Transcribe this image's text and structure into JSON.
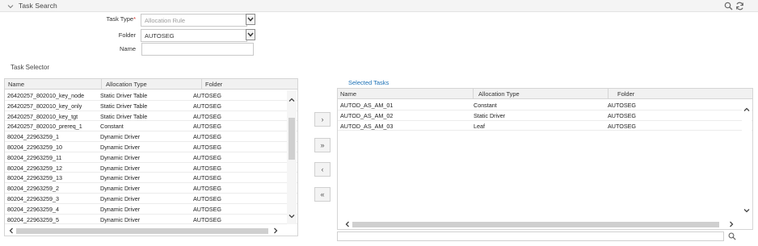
{
  "task_search": {
    "title": "Task Search",
    "task_type_label": "Task Type",
    "required_mark": "*",
    "task_type_placeholder": "Allocation Rule",
    "folder_label": "Folder",
    "folder_value": "AUTOSEG",
    "name_label": "Name",
    "name_value": ""
  },
  "header_icons": [
    "search-icon",
    "refresh-icon"
  ],
  "task_selector": {
    "title": "Task Selector",
    "columns": [
      "Name",
      "Allocation Type",
      "Folder"
    ],
    "rows": [
      [
        "26420257_802010_key_node",
        "Static Driver Table",
        "AUTOSEG"
      ],
      [
        "26420257_802010_key_only",
        "Static Driver Table",
        "AUTOSEG"
      ],
      [
        "26420257_802010_key_tgt",
        "Static Driver Table",
        "AUTOSEG"
      ],
      [
        "26420257_802010_prereq_1",
        "Constant",
        "AUTOSEG"
      ],
      [
        "80204_22963259_1",
        "Dynamic Driver",
        "AUTOSEG"
      ],
      [
        "80204_22963259_10",
        "Dynamic Driver",
        "AUTOSEG"
      ],
      [
        "80204_22963259_11",
        "Dynamic Driver",
        "AUTOSEG"
      ],
      [
        "80204_22963259_12",
        "Dynamic Driver",
        "AUTOSEG"
      ],
      [
        "80204_22963259_13",
        "Dynamic Driver",
        "AUTOSEG"
      ],
      [
        "80204_22963259_2",
        "Dynamic Driver",
        "AUTOSEG"
      ],
      [
        "80204_22963259_3",
        "Dynamic Driver",
        "AUTOSEG"
      ],
      [
        "80204_22963259_4",
        "Dynamic Driver",
        "AUTOSEG"
      ],
      [
        "80204_22963259_5",
        "Dynamic Driver",
        "AUTOSEG"
      ]
    ]
  },
  "shuttle": {
    "move_selected": "›",
    "move_all": "»",
    "remove_selected": "‹",
    "remove_all": "«"
  },
  "selected_tasks": {
    "title": "Selected Tasks",
    "columns": [
      "Name",
      "Allocation Type",
      "Folder"
    ],
    "rows": [
      [
        "AUTOD_AS_AM_01",
        "Constant",
        "AUTOSEG"
      ],
      [
        "AUTOD_AS_AM_02",
        "Static Driver",
        "AUTOSEG"
      ],
      [
        "AUTOD_AS_AM_03",
        "Leaf",
        "AUTOSEG"
      ]
    ],
    "search_value": ""
  },
  "colors": {
    "accent_link": "#1a6fb5",
    "required": "#d9322b",
    "header_bg": "#f4f4f4"
  }
}
